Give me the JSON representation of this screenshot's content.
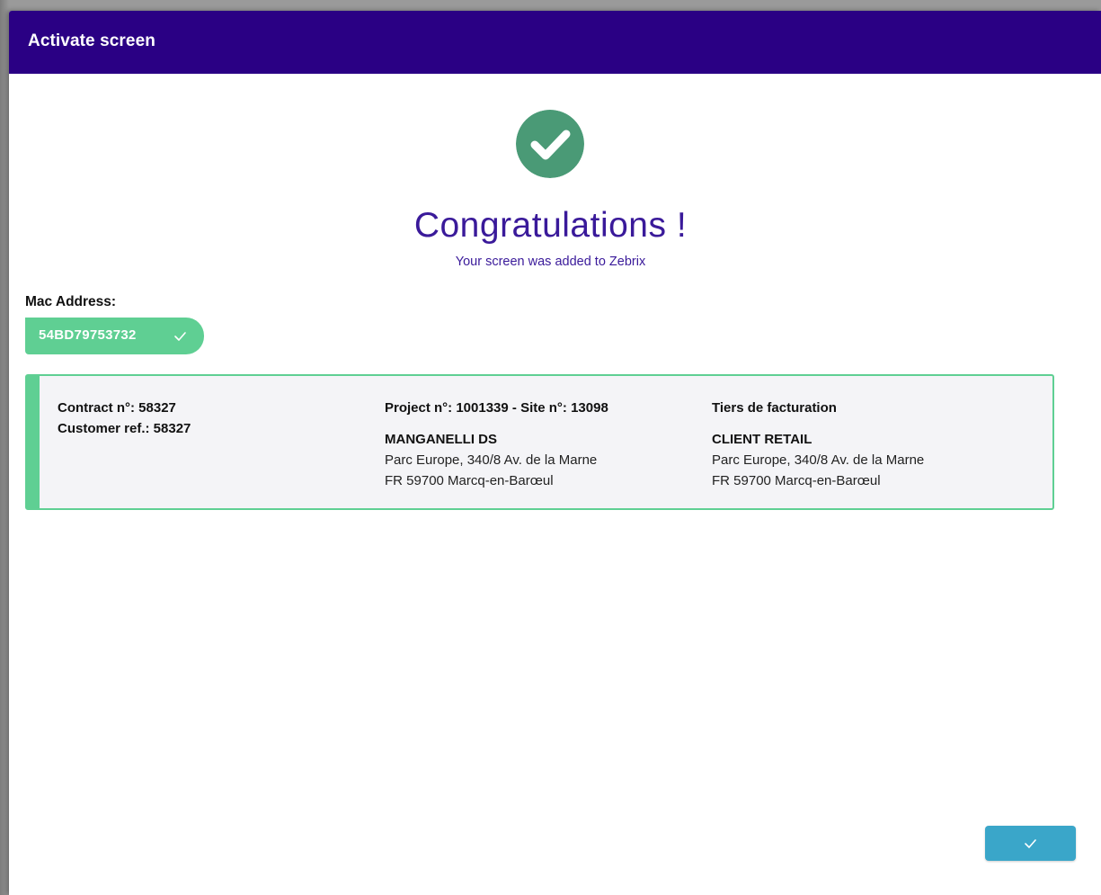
{
  "modal": {
    "title": "Activate screen"
  },
  "success": {
    "icon": "check-circle-icon",
    "heading": "Congratulations !",
    "message": "Your screen was added to Zebrix"
  },
  "mac": {
    "label": "Mac Address:",
    "value": "54BD79753732",
    "status_icon": "checkmark-icon"
  },
  "contract": {
    "contract_line": "Contract n°: 58327",
    "customer_ref_line": "Customer ref.: 58327"
  },
  "project": {
    "header": "Project n°: 1001339 - Site n°: 13098",
    "name": "MANGANELLI DS",
    "address_line1": "Parc Europe, 340/8 Av. de la Marne",
    "address_line2": "FR 59700 Marcq-en-Barœul"
  },
  "billing": {
    "header": "Tiers de facturation",
    "name": "CLIENT RETAIL",
    "address_line1": "Parc Europe, 340/8 Av. de la Marne",
    "address_line2": "FR 59700 Marcq-en-Barœul"
  },
  "footer": {
    "confirm_icon": "checkmark-icon"
  },
  "colors": {
    "header_bg": "#2a0084",
    "success_green": "#4a9a76",
    "accent_green": "#5fcf93",
    "heading_purple": "#3a1a9a",
    "confirm_blue": "#3aa6c9"
  }
}
